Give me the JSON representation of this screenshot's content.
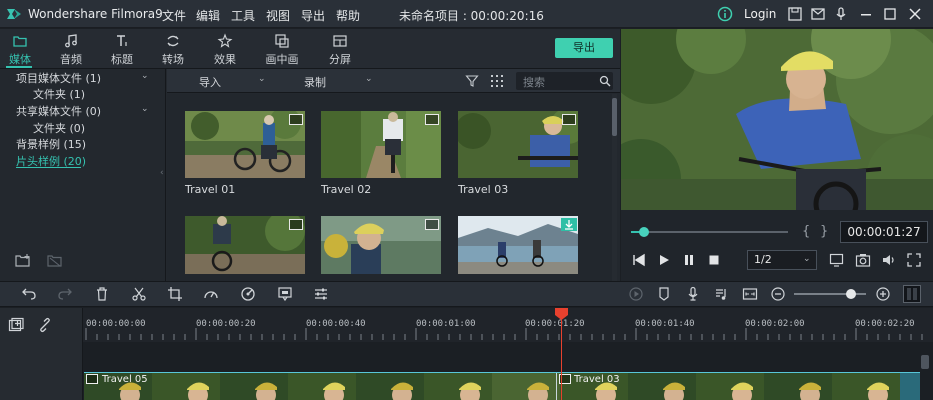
{
  "app": {
    "name": "Wondershare Filmora9"
  },
  "menu": [
    "文件",
    "编辑",
    "工具",
    "视图",
    "导出",
    "帮助"
  ],
  "project_title": "未命名项目 : 00:00:20:16",
  "titlebar_right": {
    "login": "Login"
  },
  "tabs": [
    {
      "label": "媒体",
      "icon": "folder-icon"
    },
    {
      "label": "音频",
      "icon": "music-note-icon"
    },
    {
      "label": "标题",
      "icon": "text-icon"
    },
    {
      "label": "转场",
      "icon": "transition-icon"
    },
    {
      "label": "效果",
      "icon": "effects-icon"
    },
    {
      "label": "画中画",
      "icon": "pip-icon"
    },
    {
      "label": "分屏",
      "icon": "split-screen-icon"
    }
  ],
  "export_label": "导出",
  "tree": [
    {
      "label": "项目媒体文件 (1)"
    },
    {
      "label": "文件夹 (1)"
    },
    {
      "label": "共享媒体文件 (0)"
    },
    {
      "label": "文件夹 (0)"
    },
    {
      "label": "背景样例 (15)"
    },
    {
      "label": "片头样例 (20)"
    }
  ],
  "media_toolbar": {
    "import_label": "导入",
    "record_label": "录制",
    "search_placeholder": "搜索"
  },
  "media": [
    {
      "label": "Travel 01"
    },
    {
      "label": "Travel 02"
    },
    {
      "label": "Travel 03"
    },
    {
      "label": ""
    },
    {
      "label": ""
    },
    {
      "label": ""
    }
  ],
  "preview": {
    "timecode": "00:00:01:27",
    "ratio": "1/2",
    "progress_fraction": 0.08
  },
  "ruler_ticks": [
    "00:00:00:00",
    "00:00:00:20",
    "00:00:00:40",
    "00:00:01:00",
    "00:00:01:20",
    "00:00:01:40",
    "00:00:02:00",
    "00:00:02:20"
  ],
  "clips": [
    {
      "label": "Travel 05"
    },
    {
      "label": "Travel 03"
    }
  ],
  "colors": {
    "accent": "#35c2b0",
    "playhead": "#e8412e",
    "export_button": "#3fd0b0"
  }
}
